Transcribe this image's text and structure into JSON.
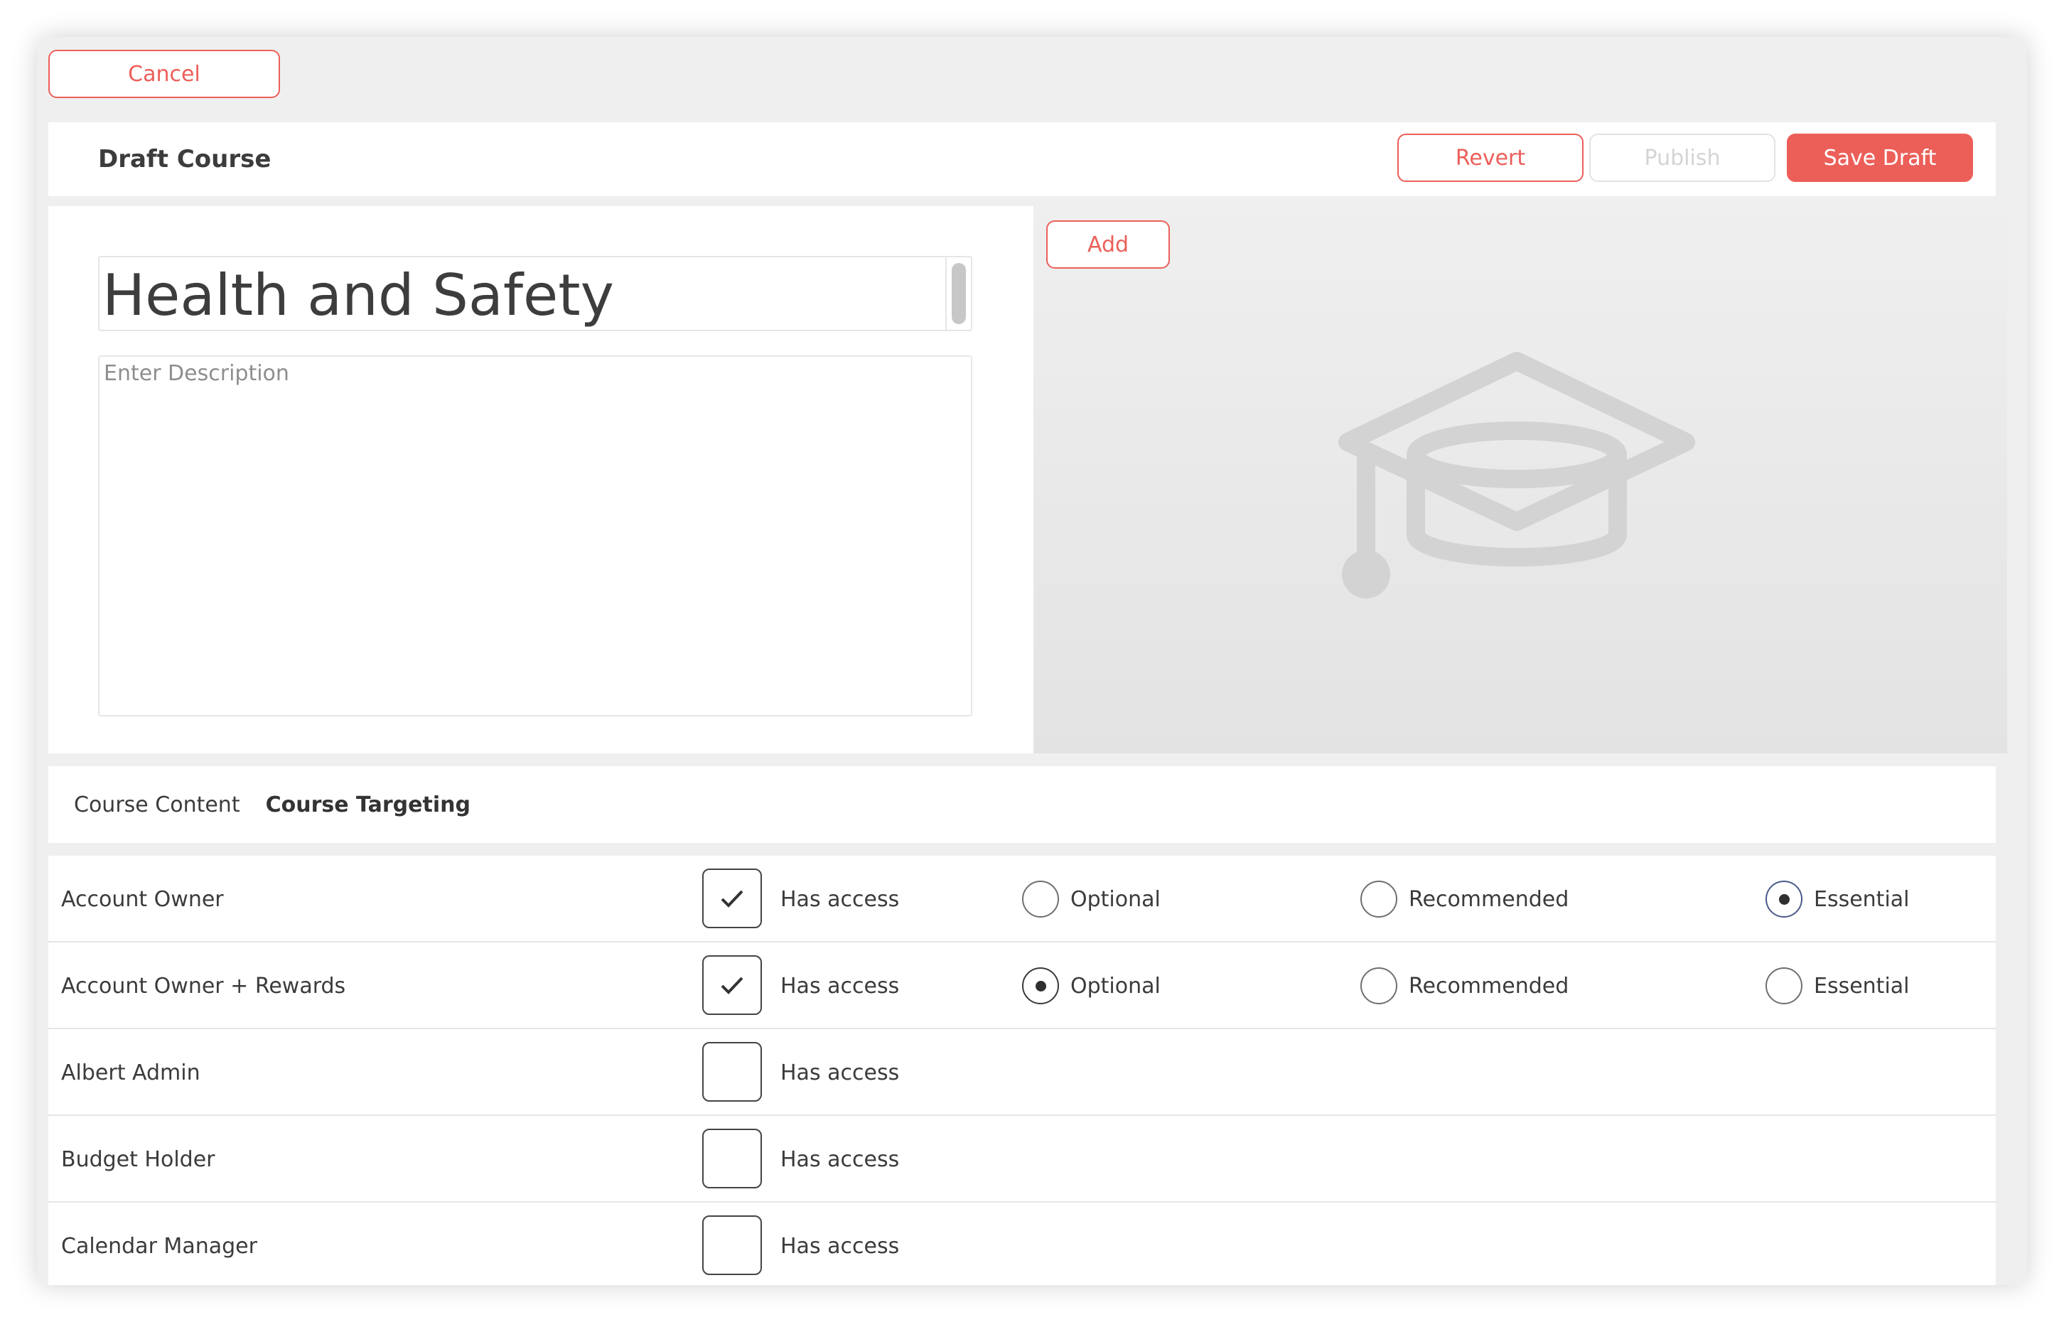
{
  "toolbar": {
    "cancel_label": "Cancel"
  },
  "header": {
    "title": "Draft Course",
    "revert_label": "Revert",
    "publish_label": "Publish",
    "save_label": "Save Draft"
  },
  "editor": {
    "course_title": "Health and Safety",
    "description_placeholder": "Enter Description",
    "add_label": "Add",
    "image_icon": "graduation-cap-icon"
  },
  "tabs": [
    {
      "label": "Course Content",
      "active": false
    },
    {
      "label": "Course Targeting",
      "active": true
    }
  ],
  "targeting": {
    "access_label": "Has access",
    "options": [
      "Optional",
      "Recommended",
      "Essential"
    ],
    "rows": [
      {
        "role": "Account Owner",
        "has_access": true,
        "selected": "Essential"
      },
      {
        "role": "Account Owner + Rewards",
        "has_access": true,
        "selected": "Optional"
      },
      {
        "role": "Albert Admin",
        "has_access": false,
        "selected": null
      },
      {
        "role": "Budget Holder",
        "has_access": false,
        "selected": null
      },
      {
        "role": "Calendar Manager",
        "has_access": false,
        "selected": null
      }
    ]
  },
  "colors": {
    "accent": "#ec5f59",
    "disabled": "#d4d4d4",
    "background": "#efefef"
  }
}
